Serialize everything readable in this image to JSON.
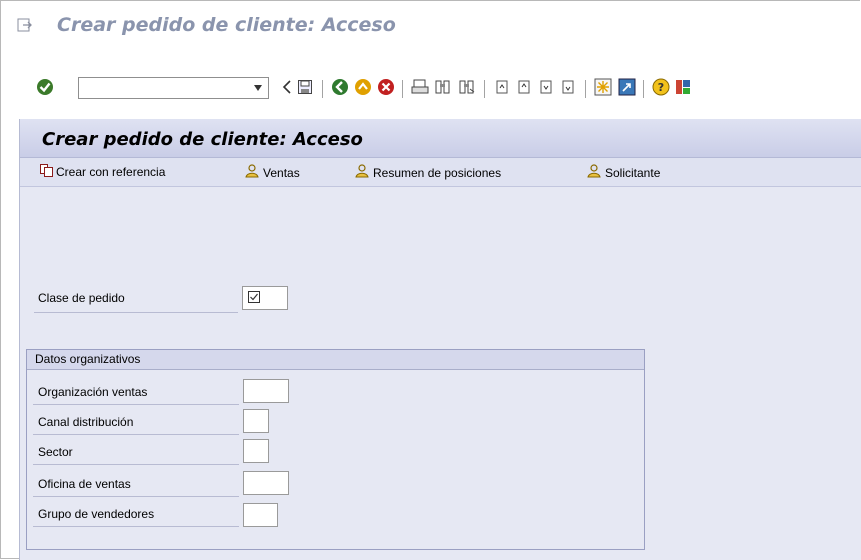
{
  "window": {
    "title": "Crear pedido de cliente: Acceso"
  },
  "toolbar": {
    "command_field_value": "",
    "icons": [
      "enter-icon",
      "back-icon",
      "save-icon",
      "back-nav-icon",
      "exit-icon",
      "cancel-icon",
      "print-icon",
      "find-icon",
      "find-next-icon",
      "first-page-icon",
      "prev-page-icon",
      "next-page-icon",
      "last-page-icon",
      "new-session-icon",
      "shortcut-icon",
      "help-icon",
      "customize-icon"
    ]
  },
  "screen": {
    "title": "Crear pedido de cliente: Acceso",
    "app_toolbar": [
      {
        "label": "Crear con referencia",
        "icon": "create-reference-icon"
      },
      {
        "label": "Ventas",
        "icon": "person-icon"
      },
      {
        "label": "Resumen de posiciones",
        "icon": "person-icon"
      },
      {
        "label": "Solicitante",
        "icon": "person-icon"
      }
    ],
    "order_type": {
      "label": "Clase de pedido",
      "value": ""
    },
    "org_data": {
      "title": "Datos organizativos",
      "fields": [
        {
          "label": "Organización ventas",
          "value": ""
        },
        {
          "label": "Canal distribución",
          "value": ""
        },
        {
          "label": "Sector",
          "value": ""
        },
        {
          "label": "Oficina de ventas",
          "value": ""
        },
        {
          "label": "Grupo de vendedores",
          "value": ""
        }
      ]
    }
  },
  "colors": {
    "title_text": "#8a94ad",
    "content_bg": "#e6e8f3",
    "header_band": "#c9cde7"
  }
}
